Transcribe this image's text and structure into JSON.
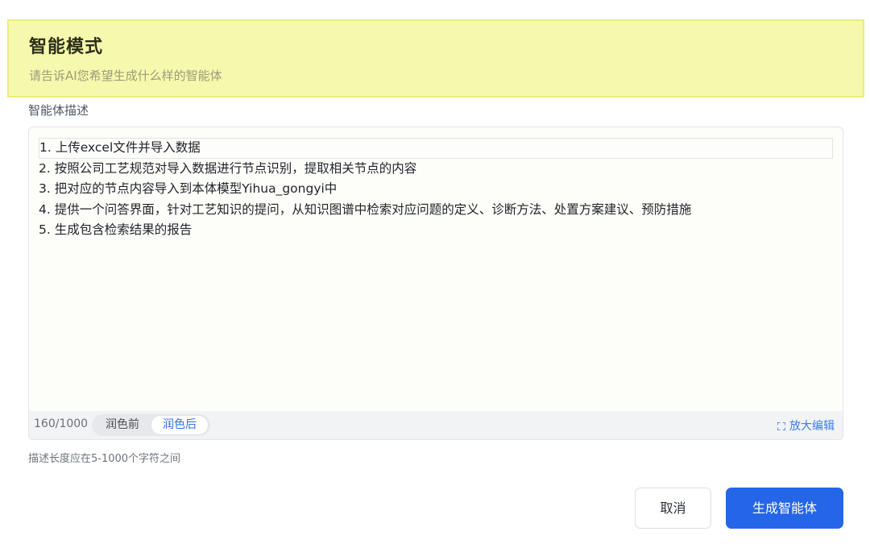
{
  "banner": {
    "title": "智能模式",
    "subtitle": "请告诉AI您希望生成什么样的智能体"
  },
  "form": {
    "label": "智能体描述",
    "lines": [
      "1. 上传excel文件并导入数据",
      "2. 按照公司工艺规范对导入数据进行节点识别，提取相关节点的内容",
      "3. 把对应的节点内容导入到本体模型Yihua_gongyi中",
      "4. 提供一个问答界面，针对工艺知识的提问，从知识图谱中检索对应问题的定义、诊断方法、处置方案建议、预防措施",
      "5. 生成包含检索结果的报告"
    ],
    "char_count": "160/1000",
    "toggle_before": "润色前",
    "toggle_after": "润色后",
    "expand_label": "放大编辑",
    "expand_icon": "expand-icon",
    "hint": "描述长度应在5-1000个字符之间"
  },
  "actions": {
    "cancel_label": "取消",
    "generate_label": "生成智能体"
  },
  "colors": {
    "banner_bg": "#f6f8ad",
    "accent": "#2566e8",
    "link": "#3d7cf0"
  }
}
